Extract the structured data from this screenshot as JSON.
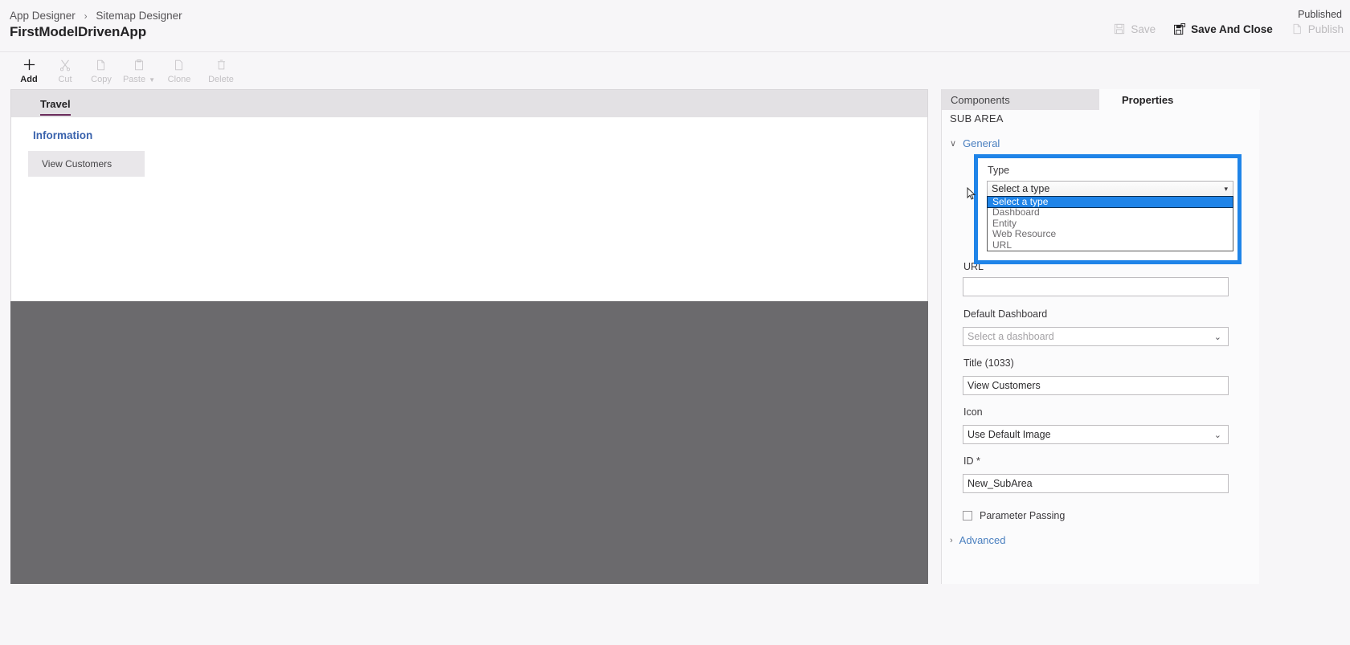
{
  "header": {
    "breadcrumb": [
      "App Designer",
      "Sitemap Designer"
    ],
    "breadcrumb_separator": "›",
    "app_title": "FirstModelDrivenApp",
    "published_status": "Published",
    "actions": [
      {
        "label": "Save",
        "icon": "save-icon",
        "enabled": false
      },
      {
        "label": "Save And Close",
        "icon": "save-and-close-icon",
        "enabled": true
      },
      {
        "label": "Publish",
        "icon": "publish-icon",
        "enabled": false
      }
    ]
  },
  "command_bar": {
    "items": [
      {
        "label": "Add",
        "icon": "plus-icon",
        "glyph": "＋",
        "enabled": true,
        "has_caret": false
      },
      {
        "label": "Cut",
        "icon": "scissors-icon",
        "glyph": "✂",
        "enabled": false,
        "has_caret": false
      },
      {
        "label": "Copy",
        "icon": "copy-icon",
        "glyph": "❐",
        "enabled": false,
        "has_caret": false
      },
      {
        "label": "Paste",
        "icon": "paste-icon",
        "glyph": "ὌB",
        "enabled": false,
        "has_caret": true
      },
      {
        "label": "Clone",
        "icon": "clone-icon",
        "glyph": "὜B",
        "enabled": false,
        "has_caret": false
      },
      {
        "label": "Delete",
        "icon": "trash-icon",
        "glyph": "Ὕ1",
        "enabled": false,
        "has_caret": false
      }
    ],
    "caret_glyph": "▼"
  },
  "canvas": {
    "tab_label": "Travel",
    "group_label": "Information",
    "subarea_label": "View Customers"
  },
  "panel": {
    "tabs": [
      {
        "label": "Components",
        "active": false
      },
      {
        "label": "Properties",
        "active": true
      }
    ],
    "section_title": "SUB AREA",
    "accordions": [
      {
        "label": "General",
        "expanded": true,
        "chevron": "∨"
      },
      {
        "label": "Advanced",
        "expanded": false,
        "chevron": "›"
      }
    ],
    "fields": {
      "type": {
        "label": "Type",
        "value": "Select a type",
        "arrow": "▾",
        "options": [
          "Select a type",
          "Dashboard",
          "Entity",
          "Web Resource",
          "URL"
        ],
        "selected_option": "Select a type",
        "open": true
      },
      "url": {
        "label": "URL",
        "value": ""
      },
      "default_dashboard": {
        "label": "Default Dashboard",
        "value": "",
        "placeholder": "Select a dashboard",
        "chevron": "⌄"
      },
      "title": {
        "label": "Title (1033)",
        "value": "View Customers"
      },
      "icon": {
        "label": "Icon",
        "value": "Use Default Image",
        "chevron": "⌄"
      },
      "id": {
        "label": "ID *",
        "value": "New_SubArea"
      },
      "parameter_passing": {
        "label": "Parameter Passing",
        "checked": false
      }
    }
  },
  "colors": {
    "accent_blue": "#1f84e8",
    "tab_underline": "#6b2d5c",
    "group_label": "#3a63ad",
    "link_blue": "#4a7fbf",
    "canvas_gray": "#6b6a6d"
  }
}
